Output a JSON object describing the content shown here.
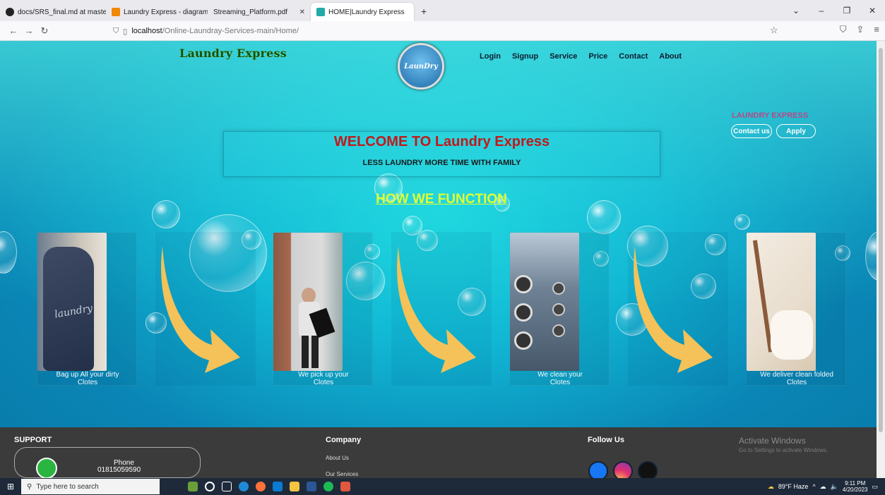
{
  "browser": {
    "tabs": [
      {
        "title": "docs/SRS_final.md at master · F",
        "color": "#222"
      },
      {
        "title": "Laundry Express - diagrams.net",
        "color": "#f08705"
      },
      {
        "title": "Streaming_Platform.pdf",
        "color": "#d33"
      },
      {
        "title": "HOME|Laundry Express",
        "color": "#1aa"
      }
    ],
    "url_host": "localhost",
    "url_path": "/Online-Laundray-Services-main/Home/"
  },
  "site": {
    "brand": "Laundry Express",
    "logo_text": "LaunDry",
    "menu": [
      "Login",
      "Signup",
      "Service",
      "Price",
      "Contact",
      "About"
    ],
    "side_brand": "LAUNDRY EXPRESS",
    "contact_btn": "Contact us",
    "apply_btn": "Apply",
    "welcome_title": "WELCOME TO Laundry Express",
    "welcome_sub": "LESS LAUNDRY MORE TIME WITH FAMILY",
    "how_title": "HOW WE FUNCTION",
    "steps": [
      {
        "caption_1": "Bag up All your dirty",
        "caption_2": "Clotes"
      },
      {
        "caption_1": "We pick up your",
        "caption_2": "Clotes"
      },
      {
        "caption_1": "We clean your",
        "caption_2": "Clotes"
      },
      {
        "caption_1": "We deliver clean folded",
        "caption_2": "Clotes"
      }
    ]
  },
  "footer": {
    "support": "SUPPORT",
    "phone_label": "Phone",
    "phone_number": "01815059590",
    "company": "Company",
    "company_links": [
      "About Us",
      "Our Services"
    ],
    "follow": "Follow Us",
    "activate_title": "Activate Windows",
    "activate_sub": "Go to Settings to activate Windows."
  },
  "taskbar": {
    "search_placeholder": "Type here to search",
    "weather": "89°F Haze",
    "time": "9:11 PM",
    "date": "4/20/2023"
  }
}
